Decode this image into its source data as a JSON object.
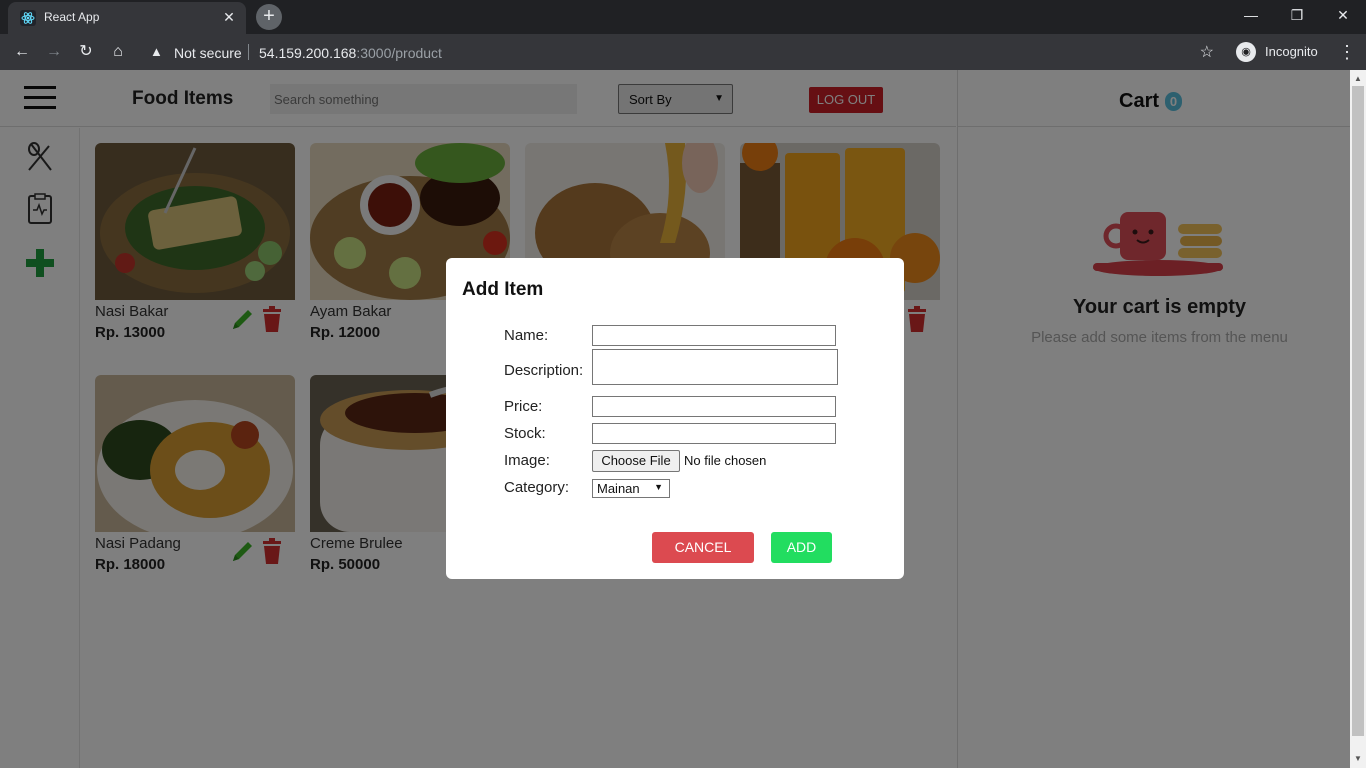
{
  "browser": {
    "tab_title": "React App",
    "not_secure": "Not secure",
    "url_host": "54.159.200.168",
    "url_path": ":3000/product",
    "incognito_label": "Incognito"
  },
  "nav": {
    "title": "Food Items",
    "search_placeholder": "Search something",
    "sort_label": "Sort By",
    "logout_label": "LOG OUT"
  },
  "products": [
    {
      "name": "Nasi Bakar",
      "price": "Rp. 13000"
    },
    {
      "name": "Ayam Bakar",
      "price": "Rp. 12000"
    },
    {
      "name": "",
      "price": ""
    },
    {
      "name": "",
      "price": ""
    },
    {
      "name": "Nasi Padang",
      "price": "Rp. 18000"
    },
    {
      "name": "Creme Brulee",
      "price": "Rp. 50000"
    }
  ],
  "cart": {
    "title": "Cart",
    "count": "0",
    "empty_title": "Your cart is empty",
    "empty_subtitle": "Please add some items from the menu"
  },
  "modal": {
    "title": "Add Item",
    "fields": {
      "name_label": "Name:",
      "description_label": "Description:",
      "price_label": "Price:",
      "stock_label": "Stock:",
      "image_label": "Image:",
      "category_label": "Category:"
    },
    "choose_file": "Choose File",
    "no_file": "No file chosen",
    "category_value": "Mainan",
    "cancel_label": "CANCEL",
    "add_label": "ADD"
  },
  "colors": {
    "logout": "#cd1f27",
    "cancel": "#dc4a50",
    "add": "#22dd60",
    "badge": "#5bc0de",
    "edit_icon": "#3cb527",
    "delete_icon": "#d32f2f",
    "add_nav_icon": "#1e9e3e"
  }
}
